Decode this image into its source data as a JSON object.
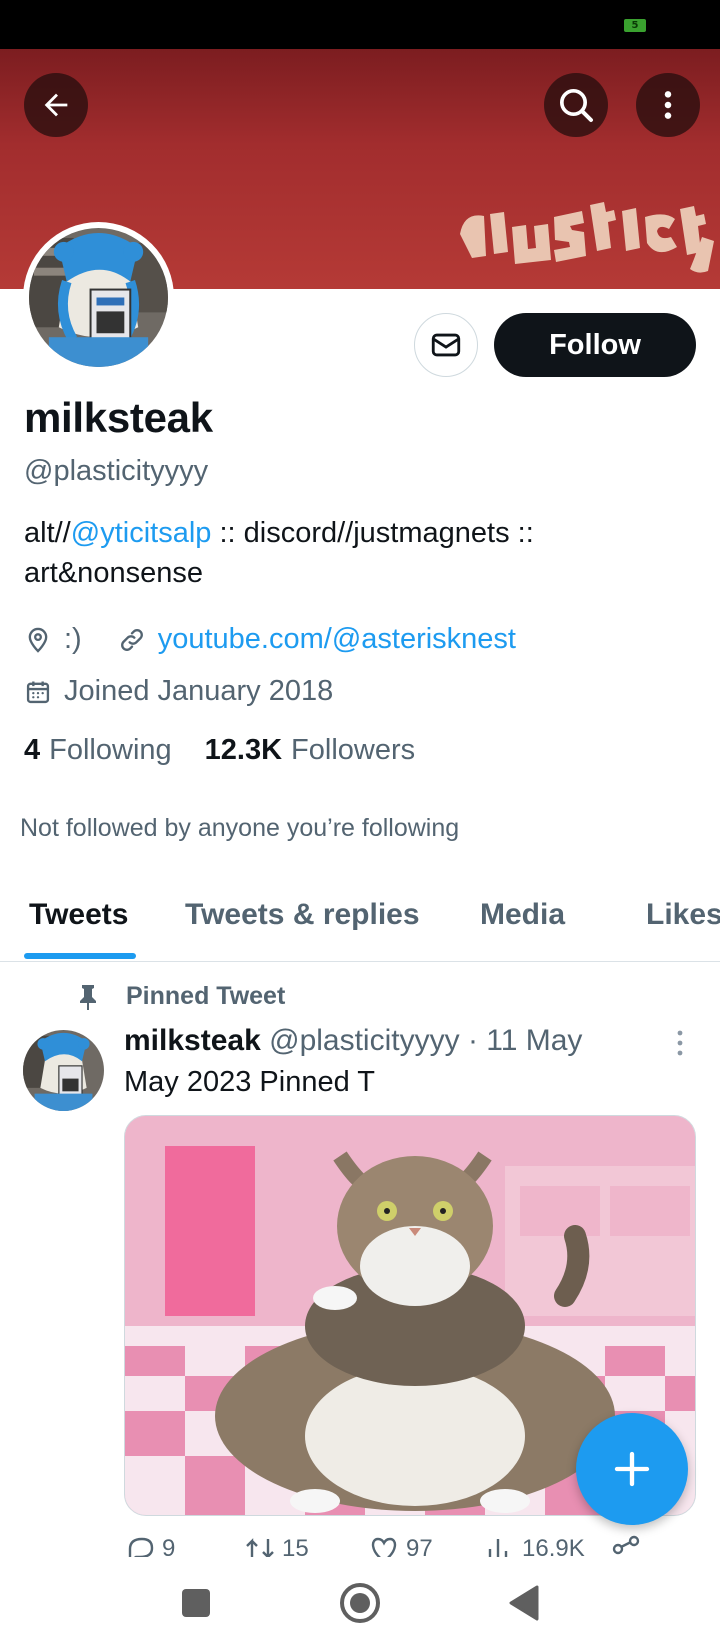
{
  "status_bar": {
    "battery_level": "5"
  },
  "header": {
    "back_icon": "arrow-left-icon",
    "search_icon": "search-icon",
    "more_icon": "more-vertical-icon",
    "banner_text": "plasticity",
    "banner_color": "#a22d2e"
  },
  "profile": {
    "display_name": "milksteak",
    "handle": "@plasticityyyy",
    "follow_label": "Follow",
    "message_icon": "envelope-icon",
    "bio": {
      "prefix": "alt//",
      "mention": "@yticitsalp",
      "suffix": " :: discord//justmagnets :: art&nonsense"
    },
    "location": ":)",
    "website": "youtube.com/@asterisknest",
    "joined": "Joined January 2018",
    "following_count": "4",
    "following_label": "Following",
    "followers_count": "12.3K",
    "followers_label": "Followers",
    "not_followed_text": "Not followed by anyone you’re following"
  },
  "tabs": [
    {
      "label": "Tweets",
      "active": true
    },
    {
      "label": "Tweets & replies",
      "active": false
    },
    {
      "label": "Media",
      "active": false
    },
    {
      "label": "Likes",
      "active": false
    }
  ],
  "pinned_tweet": {
    "pinned_label": "Pinned Tweet",
    "author_name": "milksteak",
    "author_handle": "@plasticityyyy",
    "date": "· 11 May",
    "text": "May 2023 Pinned T",
    "media_alt": "cat photo",
    "replies": "9",
    "retweets": "15",
    "likes": "97",
    "views": "16.9K"
  },
  "fab": {
    "icon": "plus-icon"
  },
  "nav": {
    "recents_icon": "square-icon",
    "home_icon": "circle-home-icon",
    "back_icon": "triangle-back-icon"
  },
  "colors": {
    "accent": "#1d9bf0",
    "text": "#0f1419",
    "muted": "#536471"
  }
}
